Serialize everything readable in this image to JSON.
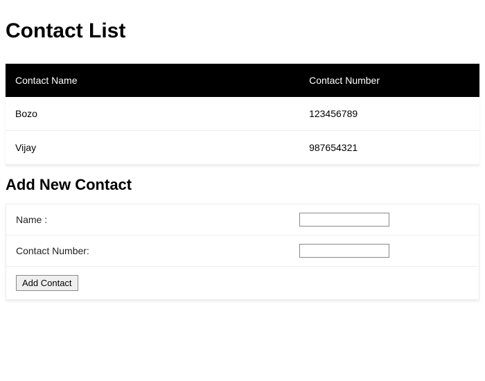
{
  "page_title": "Contact List",
  "table": {
    "headers": {
      "name": "Contact Name",
      "number": "Contact Number"
    },
    "rows": [
      {
        "name": "Bozo",
        "number": "123456789"
      },
      {
        "name": "Vijay",
        "number": "987654321"
      }
    ]
  },
  "form": {
    "title": "Add New Contact",
    "name_label": "Name :",
    "number_label": "Contact Number:",
    "name_value": "",
    "number_value": "",
    "submit_label": "Add Contact"
  }
}
